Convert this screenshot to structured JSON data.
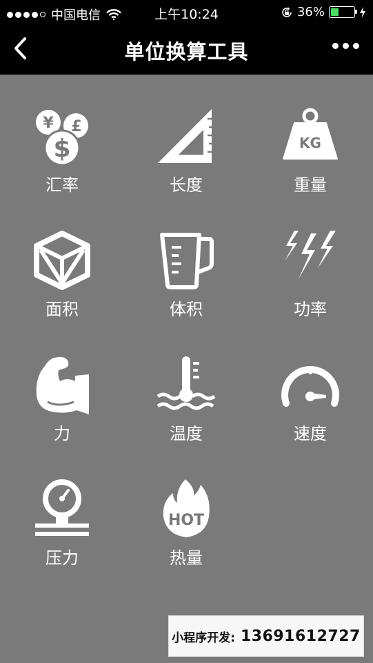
{
  "status_bar": {
    "carrier": "中国电信",
    "time": "上午10:24",
    "battery_percent": "36%",
    "battery_level": 0.36
  },
  "nav": {
    "title": "单位换算工具"
  },
  "tools": [
    {
      "label": "汇率",
      "icon": "currency-coins-icon"
    },
    {
      "label": "长度",
      "icon": "set-square-ruler-icon"
    },
    {
      "label": "重量",
      "icon": "kg-weight-icon"
    },
    {
      "label": "面积",
      "icon": "box-icon"
    },
    {
      "label": "体积",
      "icon": "measuring-cup-icon"
    },
    {
      "label": "功率",
      "icon": "lightning-bolts-icon"
    },
    {
      "label": "力",
      "icon": "flexed-arm-icon"
    },
    {
      "label": "温度",
      "icon": "thermometer-water-icon"
    },
    {
      "label": "速度",
      "icon": "speedometer-icon"
    },
    {
      "label": "压力",
      "icon": "pressure-gauge-icon"
    },
    {
      "label": "热量",
      "icon": "hot-flame-icon"
    }
  ],
  "icon_text": {
    "yen": "¥",
    "pound": "£",
    "dollar": "$",
    "kg": "KG",
    "hot": "HOT"
  },
  "watermark": {
    "label": "小程序开发:",
    "phone": "13691612727"
  },
  "colors": {
    "background": "#7a7a7a",
    "bar": "#000000",
    "battery_fill": "#4cd964"
  }
}
